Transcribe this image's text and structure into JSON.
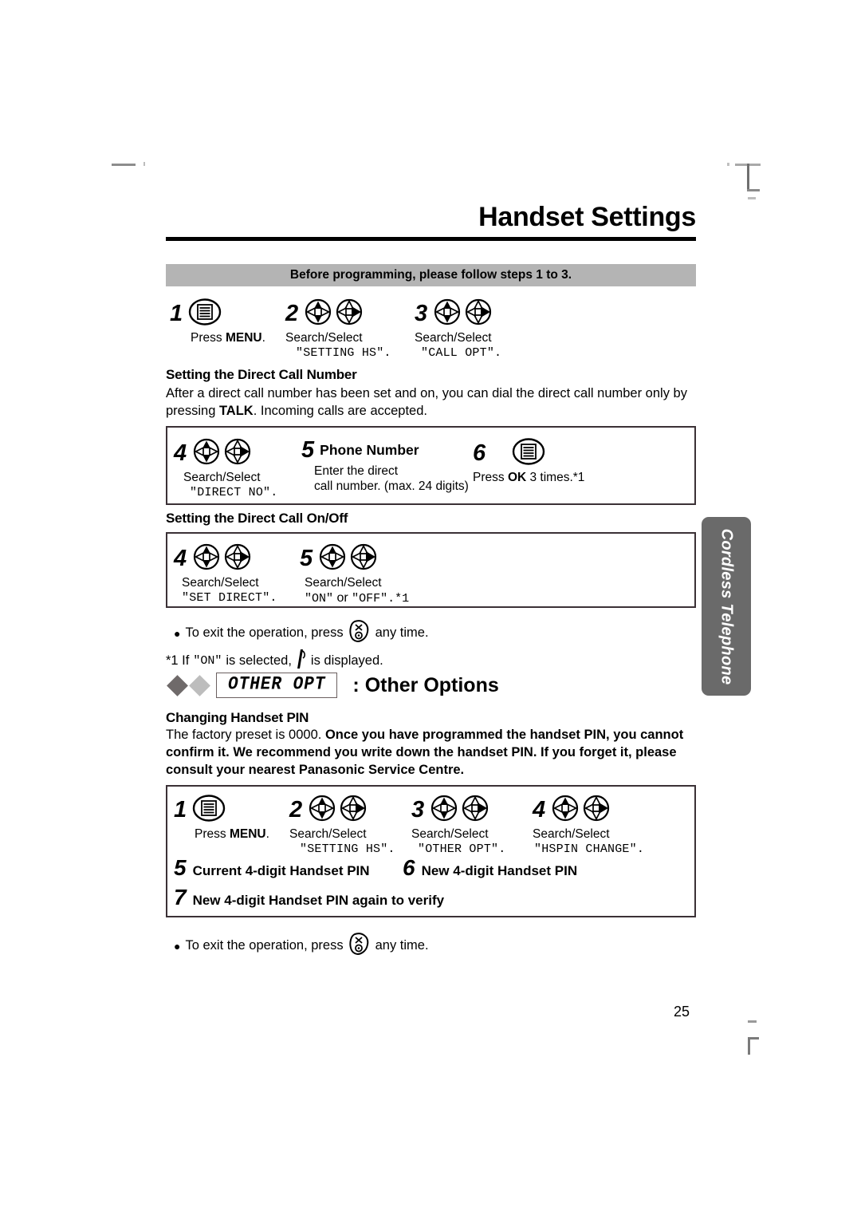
{
  "page": {
    "title": "Handset Settings",
    "number": "25",
    "side_tab": "Cordless Telephone"
  },
  "banner": {
    "text": "Before programming, please follow steps 1 to 3."
  },
  "intro_steps": [
    {
      "num": "1",
      "icon": "menu-icon",
      "caption_prefix": "Press ",
      "caption_bold": "MENU",
      "caption_suffix": ".",
      "lcd": ""
    },
    {
      "num": "2",
      "icon": "nav-key-updown-icon nav-key-right-icon",
      "caption": "Search/Select",
      "lcd": "\"SETTING HS\"."
    },
    {
      "num": "3",
      "icon": "nav-key-updown-icon nav-key-right-icon",
      "caption": "Search/Select",
      "lcd": "\"CALL OPT\"."
    }
  ],
  "section_direct_number": {
    "heading": "Setting the Direct Call Number",
    "paragraph_part1": "After a direct call number has been set and on, you can dial the direct call number only by pressing ",
    "paragraph_bold": "TALK",
    "paragraph_part2": ". Incoming calls are accepted.",
    "steps": [
      {
        "num": "4",
        "caption": "Search/Select",
        "lcd": "\"DIRECT NO\"."
      },
      {
        "num": "5",
        "title": "Phone Number",
        "line1": "Enter the direct",
        "line2": "call number. (max. 24 digits)"
      },
      {
        "num": "6",
        "caption_prefix": "Press ",
        "caption_bold": "OK",
        "caption_suffix": " 3 times.*1"
      }
    ]
  },
  "section_direct_onoff": {
    "heading": "Setting the Direct Call On/Off",
    "steps": [
      {
        "num": "4",
        "caption": "Search/Select",
        "lcd": "\"SET DIRECT\"."
      },
      {
        "num": "5",
        "caption": "Search/Select",
        "lcd_prefix": "\"ON\"",
        "lcd_mid": " or ",
        "lcd_suffix": "\"OFF\".*1"
      }
    ],
    "exit_note_prefix": "To exit the operation, press",
    "exit_note_suffix": "any time.",
    "footnote_prefix": "*1 If ",
    "footnote_on": "\"ON\"",
    "footnote_mid": " is selected,",
    "footnote_suffix": "is displayed."
  },
  "other_options": {
    "lcd_label": "OTHER OPT",
    "title": ": Other Options",
    "heading": "Changing Handset PIN",
    "paragraph_plain": "The factory preset is 0000. ",
    "paragraph_bold": "Once you have programmed the handset PIN, you cannot confirm it. We recommend you write down the handset PIN. If you forget it, please consult your nearest Panasonic Service Centre.",
    "steps": [
      {
        "num": "1",
        "caption_prefix": "Press ",
        "caption_bold": "MENU",
        "caption_suffix": ".",
        "lcd": ""
      },
      {
        "num": "2",
        "caption": "Search/Select",
        "lcd": "\"SETTING HS\"."
      },
      {
        "num": "3",
        "caption": "Search/Select",
        "lcd": "\"OTHER OPT\"."
      },
      {
        "num": "4",
        "caption": "Search/Select",
        "lcd": "\"HSPIN CHANGE\"."
      }
    ],
    "pin_steps": [
      {
        "num": "5",
        "text": "Current 4-digit Handset PIN"
      },
      {
        "num": "6",
        "text": "New 4-digit Handset PIN"
      },
      {
        "num": "7",
        "text": "New 4-digit Handset PIN again to verify"
      }
    ],
    "exit_note_prefix": "To exit the operation, press",
    "exit_note_suffix": "any time."
  },
  "colors": {
    "banner_gray": "#b4b4b4",
    "tab_gray": "#6a6a6a",
    "box_border": "#3b3136",
    "diamond_dark": "#6f6a6a",
    "diamond_light": "#bdbdbd"
  }
}
